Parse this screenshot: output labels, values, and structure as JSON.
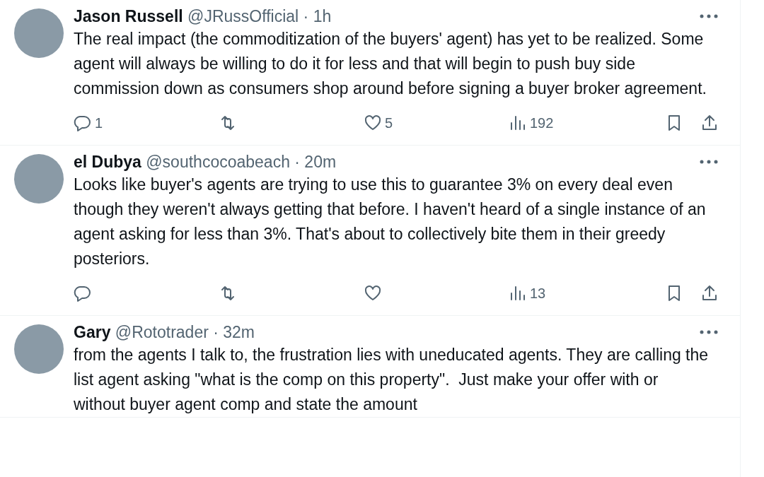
{
  "tweets": [
    {
      "name": "Jason Russell",
      "handle": "@JRussOfficial",
      "time": "· 1h",
      "text": "The real impact (the commoditization of the buyers' agent) has yet to be realized. Some agent will always be willing to do it for less and that will begin to push buy side commission down as consumers shop around before signing a buyer broker agreement.",
      "stats": {
        "replies": "1",
        "likes": "5",
        "views": "192"
      }
    },
    {
      "name": "el Dubya",
      "handle": "@southcocoabeach",
      "time": "· 20m",
      "text": "Looks like buyer's agents are trying to use this to guarantee 3% on every deal even though they weren't always getting that before. I haven't heard of a single instance of an agent asking for less than 3%. That's about to collectively bite them in their greedy posteriors.",
      "stats": {
        "views": "13"
      }
    },
    {
      "name": "Gary",
      "handle": "@Rototrader",
      "time": "· 32m",
      "text": "from the agents I talk to, the frustration lies with uneducated agents. They are calling the list agent asking \"what is the comp on this property\".  Just make your offer with or without buyer agent comp and state the amount"
    }
  ]
}
